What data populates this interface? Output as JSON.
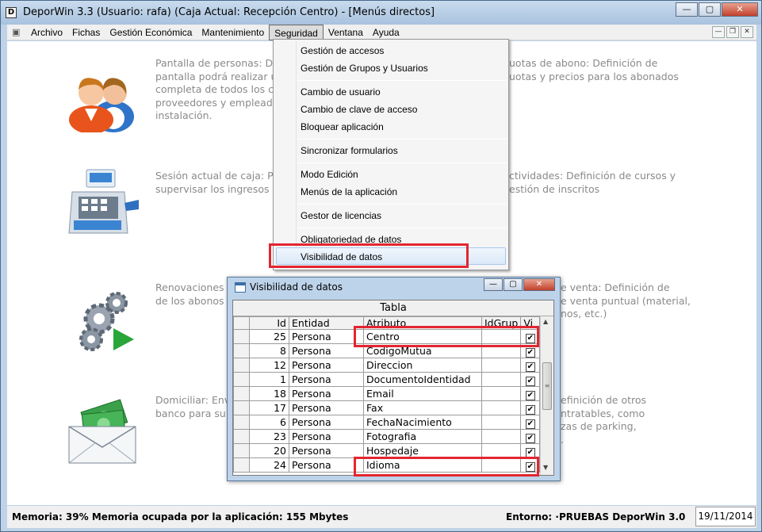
{
  "window": {
    "title": "DeporWin 3.3  (Usuario: rafa)  (Caja Actual: Recepción Centro) - [Menús directos]",
    "app_icon": "D",
    "controls": {
      "minimize": "—",
      "maximize": "▢",
      "close": "✕"
    }
  },
  "menubar": {
    "items": [
      "Archivo",
      "Fichas",
      "Gestión Económica",
      "Mantenimiento",
      "Seguridad",
      "Ventana",
      "Ayuda"
    ],
    "active": "Seguridad"
  },
  "tiles": [
    {
      "icon": "people-icon",
      "text": "Pantalla de personas: De\npantalla podrá realizar un\ncompleta de todos los cli\nproveedores y empleado\ninstalación."
    },
    {
      "icon": "cash-register-icon",
      "text": "Sesión actual de caja: Pa\nsupervisar los ingresos d"
    },
    {
      "icon": "gears-play-icon",
      "text": "Renovaciones\nde los abonos"
    },
    {
      "icon": "money-envelope-icon",
      "text": "Domiciliar: Envi\nbanco para su c"
    }
  ],
  "tiles_right": [
    {
      "text": "uotas de abono: Definición de\nuotas y precios para los abonados"
    },
    {
      "text": "ctividades: Definición de cursos y\nestión de inscritos"
    },
    {
      "text": "e venta: Definición de\ne venta puntual (material,\nnos, etc.)"
    },
    {
      "text": "efinición de otros\nntratables, como\nzas de parking,\n."
    }
  ],
  "dropdown": {
    "groups": [
      [
        "Gestión de accesos",
        "Gestión de Grupos y Usuarios"
      ],
      [
        "Cambio de usuario",
        "Cambio de clave de acceso",
        "Bloquear aplicación"
      ],
      [
        "Sincronizar formularios"
      ],
      [
        "Modo Edición",
        "Menús de la aplicación"
      ],
      [
        "Gestor de licencias"
      ],
      [
        "Obligatoriedad de datos",
        "Visibilidad de datos"
      ]
    ],
    "highlighted": "Visibilidad de datos"
  },
  "subwindow": {
    "title": "Visibilidad de datos",
    "caption": "Tabla",
    "columns": [
      "Id",
      "Entidad",
      "Atributo",
      "IdGrup",
      "Vi"
    ],
    "rows": [
      {
        "id": "25",
        "entidad": "Persona",
        "atributo": "Centro",
        "visible": true
      },
      {
        "id": "8",
        "entidad": "Persona",
        "atributo": "CodigoMutua",
        "visible": true
      },
      {
        "id": "12",
        "entidad": "Persona",
        "atributo": "Direccion",
        "visible": true
      },
      {
        "id": "1",
        "entidad": "Persona",
        "atributo": "DocumentoIdentidad",
        "visible": true
      },
      {
        "id": "18",
        "entidad": "Persona",
        "atributo": "Email",
        "visible": true
      },
      {
        "id": "17",
        "entidad": "Persona",
        "atributo": "Fax",
        "visible": true
      },
      {
        "id": "6",
        "entidad": "Persona",
        "atributo": "FechaNacimiento",
        "visible": true
      },
      {
        "id": "23",
        "entidad": "Persona",
        "atributo": "Fotografia",
        "visible": true
      },
      {
        "id": "20",
        "entidad": "Persona",
        "atributo": "Hospedaje",
        "visible": true
      },
      {
        "id": "24",
        "entidad": "Persona",
        "atributo": "Idioma",
        "visible": true
      }
    ]
  },
  "statusbar": {
    "memory": "Memoria: 39%  Memoria ocupada por la aplicación: 155 Mbytes",
    "environment": "Entorno: ·PRUEBAS DeporWin 3.0",
    "date": "19/11/2014"
  },
  "colors": {
    "highlight_box": "#e32630",
    "frame": "#bfd3e8"
  }
}
